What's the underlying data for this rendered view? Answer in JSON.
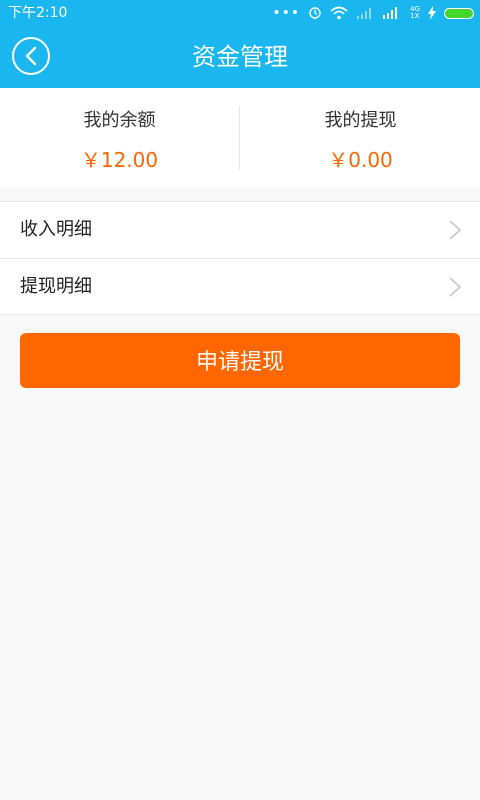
{
  "status_bar": {
    "time": "下午2:10",
    "net_label": "4G",
    "net_sub": "1X",
    "colors": {
      "battery": "#44d62c"
    }
  },
  "header": {
    "title": "资金管理",
    "back_icon": "back-circle-icon",
    "color": "#1ab6f0"
  },
  "balance": {
    "my_balance_label": "我的余额",
    "my_balance_value": "￥12.00",
    "my_withdraw_label": "我的提现",
    "my_withdraw_value": "￥0.00",
    "value_color": "#ff6600"
  },
  "menu": {
    "items": [
      {
        "label": "收入明细",
        "icon": "chevron-right-icon"
      },
      {
        "label": "提现明细",
        "icon": "chevron-right-icon"
      }
    ]
  },
  "actions": {
    "apply_label": "申请提现",
    "apply_color": "#ff6600"
  }
}
